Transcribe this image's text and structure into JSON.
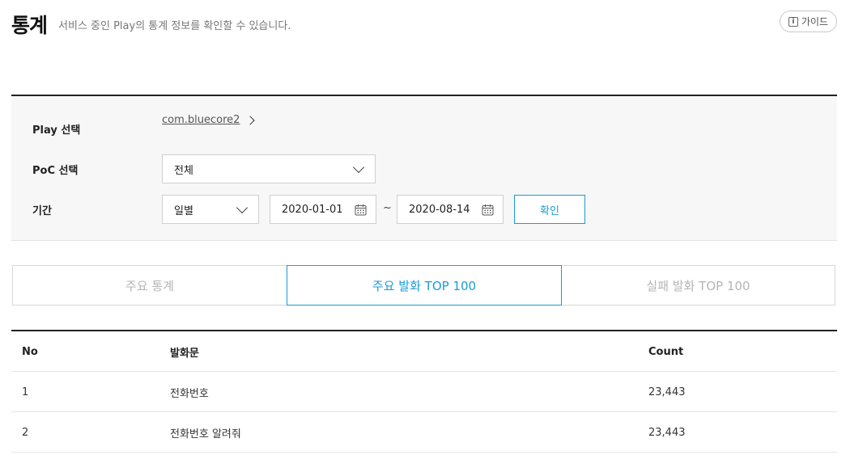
{
  "header": {
    "title": "통계",
    "description": "서비스 중인 Play의 통계 정보를 확인할 수 있습니다.",
    "guide_label": "가이드",
    "guide_icon": "info-icon"
  },
  "filters": {
    "play_label": "Play 선택",
    "play_value": "com.bluecore2",
    "poc_label": "PoC 선택",
    "poc_value": "전체",
    "period_label": "기간",
    "period_unit": "일별",
    "start_date": "2020-01-01",
    "range_separator": "~",
    "end_date": "2020-08-14",
    "confirm_label": "확인"
  },
  "tabs": [
    {
      "label": "주요 통계",
      "active": false
    },
    {
      "label": "주요 발화 TOP 100",
      "active": true
    },
    {
      "label": "실패 발화 TOP 100",
      "active": false
    }
  ],
  "table": {
    "columns": [
      "No",
      "발화문",
      "Count"
    ],
    "rows": [
      {
        "no": "1",
        "text": "전화번호",
        "count": "23,443"
      },
      {
        "no": "2",
        "text": "전화번호 알려줘",
        "count": "23,443"
      }
    ]
  },
  "colors": {
    "accent": "#1a9bd7",
    "panel_bg": "#f7f7f7",
    "inactive_tab_text": "#b5b5b5"
  }
}
